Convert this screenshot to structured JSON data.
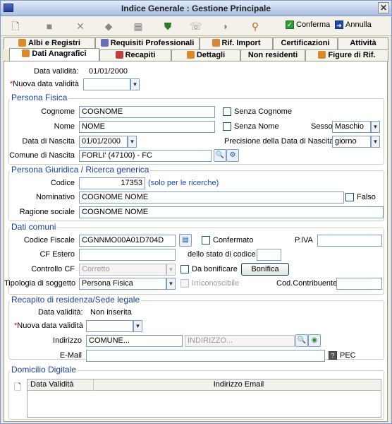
{
  "window": {
    "title": "Indice Generale : Gestione Principale"
  },
  "toolbar": {
    "confirm_label": "Conferma",
    "cancel_label": "Annulla",
    "icons": [
      "new-document-icon",
      "save-icon",
      "delete-icon",
      "handshake-icon",
      "calculator-icon",
      "shield-icon",
      "phone-icon",
      "helmet-icon",
      "search-key-icon"
    ]
  },
  "tabs_top": [
    {
      "label": "Albi e Registri"
    },
    {
      "label": "Requisiti Professionali"
    },
    {
      "label": "Rif. Import"
    },
    {
      "label": "Certificazioni"
    },
    {
      "label": "Attività"
    }
  ],
  "tabs_bottom": [
    {
      "label": "Dati Anagrafici",
      "active": true
    },
    {
      "label": "Recapiti"
    },
    {
      "label": "Dettagli"
    },
    {
      "label": "Non residenti"
    },
    {
      "label": "Figure di Rif."
    }
  ],
  "header": {
    "validity_label": "Data validità:",
    "validity_value": "01/01/2000",
    "new_validity_label": "Nuova data validità",
    "required_mark": "*"
  },
  "persona_fisica": {
    "title": "Persona Fisica",
    "cognome_label": "Cognome",
    "cognome_value": "COGNOME",
    "senza_cognome_label": "Senza Cognome",
    "nome_label": "Nome",
    "nome_value": "NOME",
    "senza_nome_label": "Senza Nome",
    "sesso_label": "Sesso",
    "sesso_value": "Maschio",
    "data_nascita_label": "Data di Nascita",
    "data_nascita_value": "01/01/2000",
    "precisione_label": "Precisione della Data di Nascita al",
    "precisione_value": "giorno",
    "comune_label": "Comune di Nascita",
    "comune_value": "FORLI' (47100) - FC"
  },
  "persona_giuridica": {
    "title": "Persona Giuridica / Ricerca generica",
    "codice_label": "Codice",
    "codice_value": "17353",
    "codice_note": "(solo per le ricerche)",
    "nominativo_label": "Nominativo",
    "nominativo_value": "COGNOME NOME",
    "falso_label": "Falso",
    "ragione_label": "Ragione sociale",
    "ragione_value": "COGNOME NOME"
  },
  "dati_comuni": {
    "title": "Dati comuni",
    "cf_label": "Codice Fiscale",
    "cf_value": "CGNNMO00A01D704D",
    "confermato_label": "Confermato",
    "piva_label": "P.IVA",
    "cf_estero_label": "CF Estero",
    "stato_label": "dello stato di codice",
    "controllo_label": "Controllo CF",
    "controllo_value": "Corretto",
    "bonificare_label": "Da bonificare",
    "bonifica_button": "Bonifica",
    "tipologia_label": "Tipologia di soggetto",
    "tipologia_value": "Persona Fisica",
    "irriconoscibile_label": "Irriconoscibile",
    "contribuente_label": "Cod.Contribuente"
  },
  "recapito": {
    "title": "Recapito di residenza/Sede legale",
    "validity_label": "Data validità:",
    "validity_value": "Non inserita",
    "new_validity_label": "Nuova data validità",
    "indirizzo_label": "Indirizzo",
    "comune_placeholder": "COMUNE...",
    "indirizzo_placeholder": "INDIRIZZO...",
    "email_label": "E-Mail",
    "pec_label": "PEC",
    "pec_icon": "?"
  },
  "domicilio": {
    "title": "Domicilio Digitale",
    "columns": [
      "Data Validità",
      "Indirizzo Email"
    ]
  },
  "colors": {
    "accent": "#1a3f9e",
    "required": "#dd0000",
    "border": "#7f9db9"
  }
}
